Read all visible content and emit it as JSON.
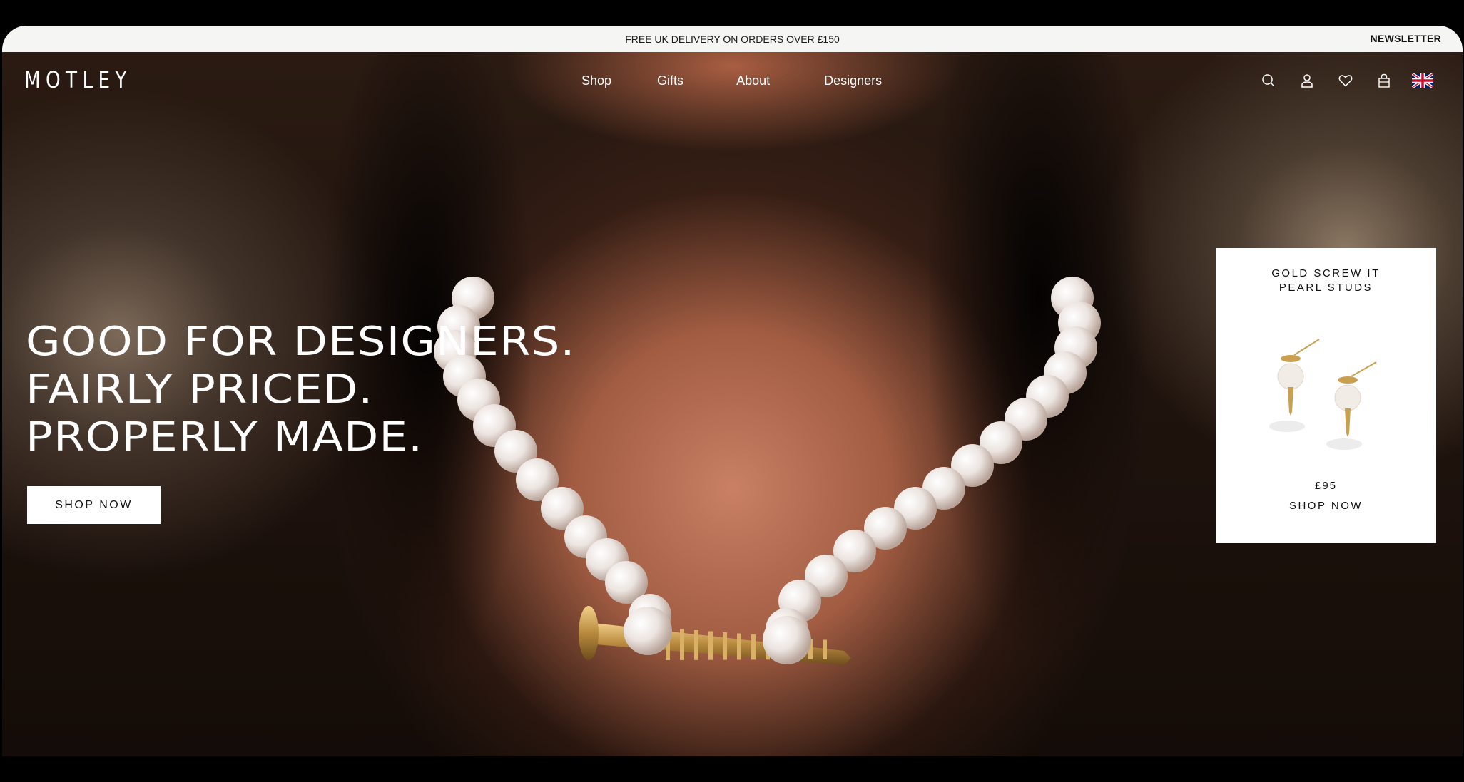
{
  "announcement": {
    "text": "FREE UK DELIVERY ON ORDERS OVER £150",
    "newsletter_label": "NEWSLETTER"
  },
  "header": {
    "logo": "MOTLEY",
    "nav": [
      "Shop",
      "Gifts",
      "About",
      "Designers"
    ],
    "icons": [
      "search-icon",
      "account-icon",
      "wishlist-heart-icon",
      "bag-icon",
      "uk-flag-icon"
    ]
  },
  "hero": {
    "headline_lines": [
      "GOOD FOR DESIGNERS.",
      "FAIRLY PRICED.",
      "PROPERLY MADE."
    ],
    "cta_label": "SHOP NOW"
  },
  "product_card": {
    "title_lines": [
      "GOLD SCREW IT",
      "PEARL STUDS"
    ],
    "price": "£95",
    "cta_label": "SHOP NOW"
  },
  "colors": {
    "announcement_bg": "#f5f5f4",
    "text_dark": "#111111",
    "white": "#ffffff"
  }
}
